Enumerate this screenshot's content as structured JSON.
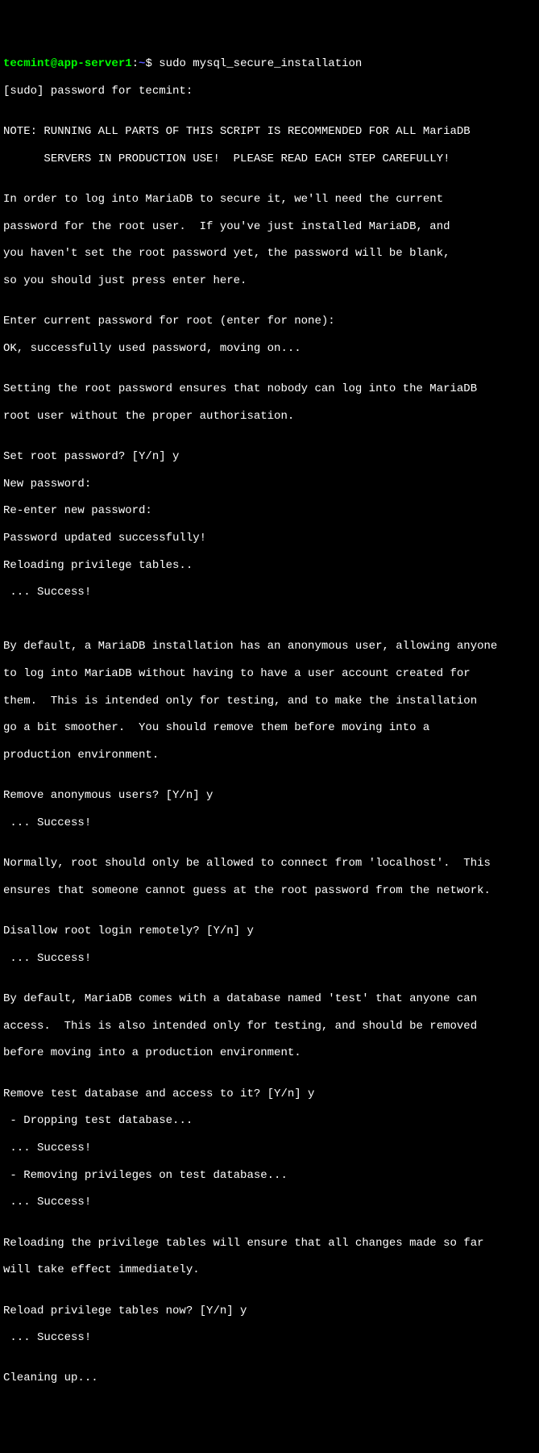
{
  "prompt": {
    "user": "tecmint@app-server1",
    "separator": ":",
    "path": "~",
    "symbol": "$ "
  },
  "command": "sudo mysql_secure_installation",
  "lines": [
    "[sudo] password for tecmint:",
    "",
    "NOTE: RUNNING ALL PARTS OF THIS SCRIPT IS RECOMMENDED FOR ALL MariaDB",
    "      SERVERS IN PRODUCTION USE!  PLEASE READ EACH STEP CAREFULLY!",
    "",
    "In order to log into MariaDB to secure it, we'll need the current",
    "password for the root user.  If you've just installed MariaDB, and",
    "you haven't set the root password yet, the password will be blank,",
    "so you should just press enter here.",
    "",
    "Enter current password for root (enter for none):",
    "OK, successfully used password, moving on...",
    "",
    "Setting the root password ensures that nobody can log into the MariaDB",
    "root user without the proper authorisation.",
    "",
    "Set root password? [Y/n] y",
    "New password:",
    "Re-enter new password:",
    "Password updated successfully!",
    "Reloading privilege tables..",
    " ... Success!",
    "",
    "",
    "By default, a MariaDB installation has an anonymous user, allowing anyone",
    "to log into MariaDB without having to have a user account created for",
    "them.  This is intended only for testing, and to make the installation",
    "go a bit smoother.  You should remove them before moving into a",
    "production environment.",
    "",
    "Remove anonymous users? [Y/n] y",
    " ... Success!",
    "",
    "Normally, root should only be allowed to connect from 'localhost'.  This",
    "ensures that someone cannot guess at the root password from the network.",
    "",
    "Disallow root login remotely? [Y/n] y",
    " ... Success!",
    "",
    "By default, MariaDB comes with a database named 'test' that anyone can",
    "access.  This is also intended only for testing, and should be removed",
    "before moving into a production environment.",
    "",
    "Remove test database and access to it? [Y/n] y",
    " - Dropping test database...",
    " ... Success!",
    " - Removing privileges on test database...",
    " ... Success!",
    "",
    "Reloading the privilege tables will ensure that all changes made so far",
    "will take effect immediately.",
    "",
    "Reload privilege tables now? [Y/n] y",
    " ... Success!",
    "",
    "Cleaning up..."
  ]
}
